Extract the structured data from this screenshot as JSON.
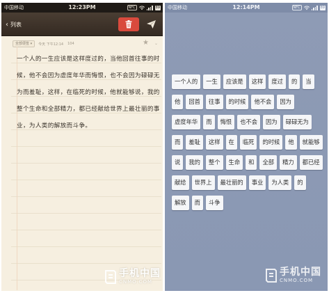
{
  "left_phone": {
    "status_bar": {
      "carrier": "中国移动",
      "time": "12:23PM",
      "nfc": "NFC",
      "battery": "89"
    },
    "nav": {
      "back_label": "列表"
    },
    "meta": {
      "folder_label": "全部便签 ▾",
      "date": "今天 下午12:14",
      "char_count": "104"
    },
    "note_text": "一个人的一生应该是这样度过的，当他回首往事的时候，他不会因为虚度年华而悔恨，也不会因为碌碌无为而羞耻，这样，在临死的时候，他就能够说，我的整个生命和全部精力，都已经献给世界上最壮丽的事业，为人类的解放而斗争。",
    "watermark": {
      "cn": "手机中国",
      "en": "CNMO.COM"
    }
  },
  "right_phone": {
    "status_bar": {
      "carrier": "中国移动",
      "time": "12:14PM",
      "nfc": "NFC",
      "battery": "89"
    },
    "token_rows": [
      [
        "一个人的",
        "一生",
        "应该是",
        "这样",
        "度过",
        "的",
        "当"
      ],
      [
        "他",
        "回首",
        "往事",
        "的时候",
        "他不会",
        "因为"
      ],
      [
        "虚度年华",
        "而",
        "悔恨",
        "也不会",
        "因为",
        "碌碌无为"
      ],
      [
        "而",
        "羞耻",
        "这样",
        "在",
        "临死",
        "的时候",
        "他",
        "就能够"
      ],
      [
        "说",
        "我的",
        "整个",
        "生命",
        "和",
        "全部",
        "精力",
        "都已经"
      ],
      [
        "献给",
        "世界上",
        "最壮丽的",
        "事业",
        "为人类",
        "的"
      ],
      [
        "解放",
        "而",
        "斗争"
      ]
    ],
    "watermark": {
      "cn": "手机中国",
      "en": "CNMO.COM"
    }
  },
  "colors": {
    "delete_red": "#d94a3d",
    "paper": "#f6efe0",
    "nav_brown": "#3f342b",
    "right_bg": "#8d9ab4"
  },
  "icons": {
    "back": "chevron-left-icon",
    "delete": "trash-icon",
    "send": "paper-plane-icon",
    "star": "star-icon"
  }
}
